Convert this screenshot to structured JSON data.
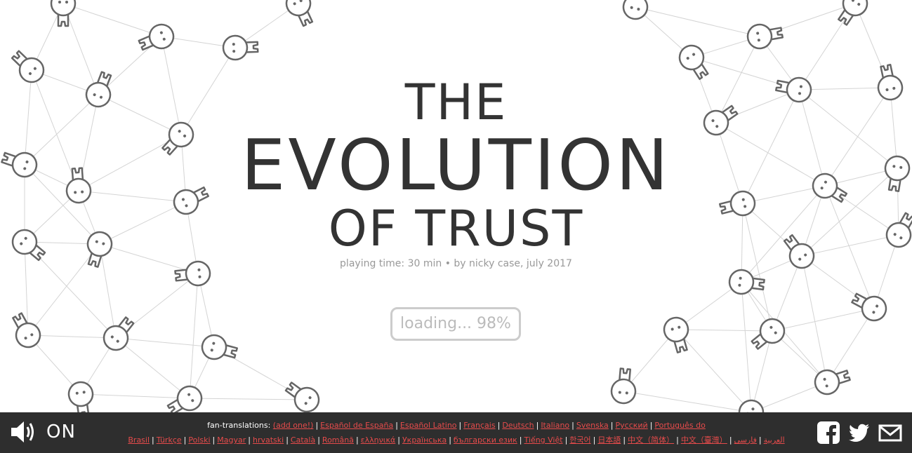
{
  "title": {
    "line1": "THE",
    "line2": "EVOLUTION",
    "line3": "OF TRUST"
  },
  "subtitle": "playing time: 30 min • by nicky case, july 2017",
  "loading": {
    "label": "loading... 98%",
    "progress": 0.98
  },
  "footer": {
    "sound_label": "ON",
    "translations_label": "fan-translations:",
    "add_link": "(add one!)",
    "languages": [
      "Español de España",
      "Español Latino",
      "Français",
      "Deutsch",
      "Italiano",
      "Svenska",
      "Русский",
      "Português do Brasil",
      "Türkçe",
      "Polski",
      "Magyar",
      "hrvatski",
      "Català",
      "Română",
      "ελληνικά",
      "Українська",
      "български език",
      "Tiếng Việt",
      "한국어",
      "日本語",
      "中文（简体）",
      "中文（臺灣）",
      "العربية",
      "فارسی"
    ]
  },
  "icons": {
    "sound": "speaker-icon",
    "facebook": "facebook-icon",
    "twitter": "twitter-icon",
    "email": "email-icon"
  },
  "colors": {
    "link": "#e64b4b",
    "footer_bg": "#2e2e2e",
    "text": "#333333",
    "figure": "#666666"
  }
}
